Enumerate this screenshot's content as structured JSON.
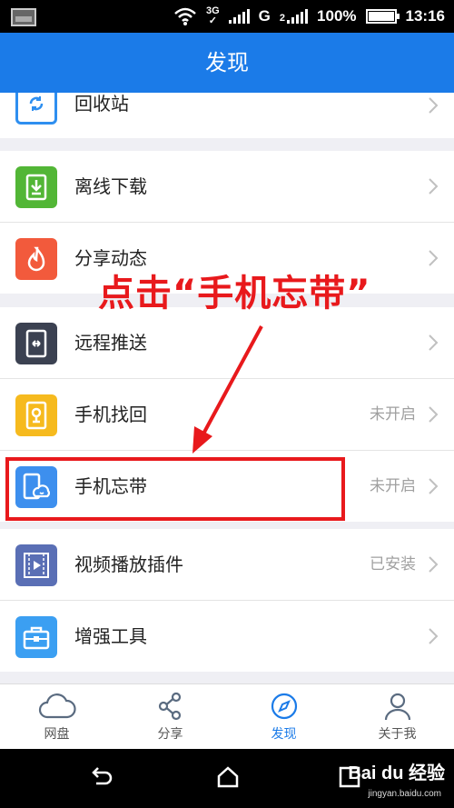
{
  "status_bar": {
    "network_3g": "3G",
    "network_g": "G",
    "network_2": "2",
    "battery": "100%",
    "time": "13:16"
  },
  "title": "发现",
  "rows": [
    {
      "label": "回收站",
      "status": "",
      "icon": "recycle-bin-icon",
      "color": "#2e8ff0"
    },
    {
      "label": "离线下载",
      "status": "",
      "icon": "offline-download-icon",
      "color": "#52b636"
    },
    {
      "label": "分享动态",
      "status": "",
      "icon": "flame-icon",
      "color": "#f25a3c"
    },
    {
      "label": "远程推送",
      "status": "",
      "icon": "remote-push-icon",
      "color": "#3b4151"
    },
    {
      "label": "手机找回",
      "status": "未开启",
      "icon": "phone-locate-icon",
      "color": "#f6ba1e"
    },
    {
      "label": "手机忘带",
      "status": "未开启",
      "icon": "phone-cloud-icon",
      "color": "#3d8fee"
    },
    {
      "label": "视频播放插件",
      "status": "已安装",
      "icon": "video-play-icon",
      "color": "#5a6fb5"
    },
    {
      "label": "增强工具",
      "status": "",
      "icon": "toolbox-icon",
      "color": "#3b9ff2"
    }
  ],
  "annotation": "点击“手机忘带”",
  "bottom_nav": [
    {
      "label": "网盘",
      "icon": "cloud-icon"
    },
    {
      "label": "分享",
      "icon": "share-icon"
    },
    {
      "label": "发现",
      "icon": "compass-icon"
    },
    {
      "label": "关于我",
      "icon": "user-icon"
    }
  ],
  "watermark": "Bai du 经验",
  "watermark_url": "jingyan.baidu.com",
  "colors": {
    "accent": "#1b7be8",
    "annotation_red": "#e8191c"
  }
}
